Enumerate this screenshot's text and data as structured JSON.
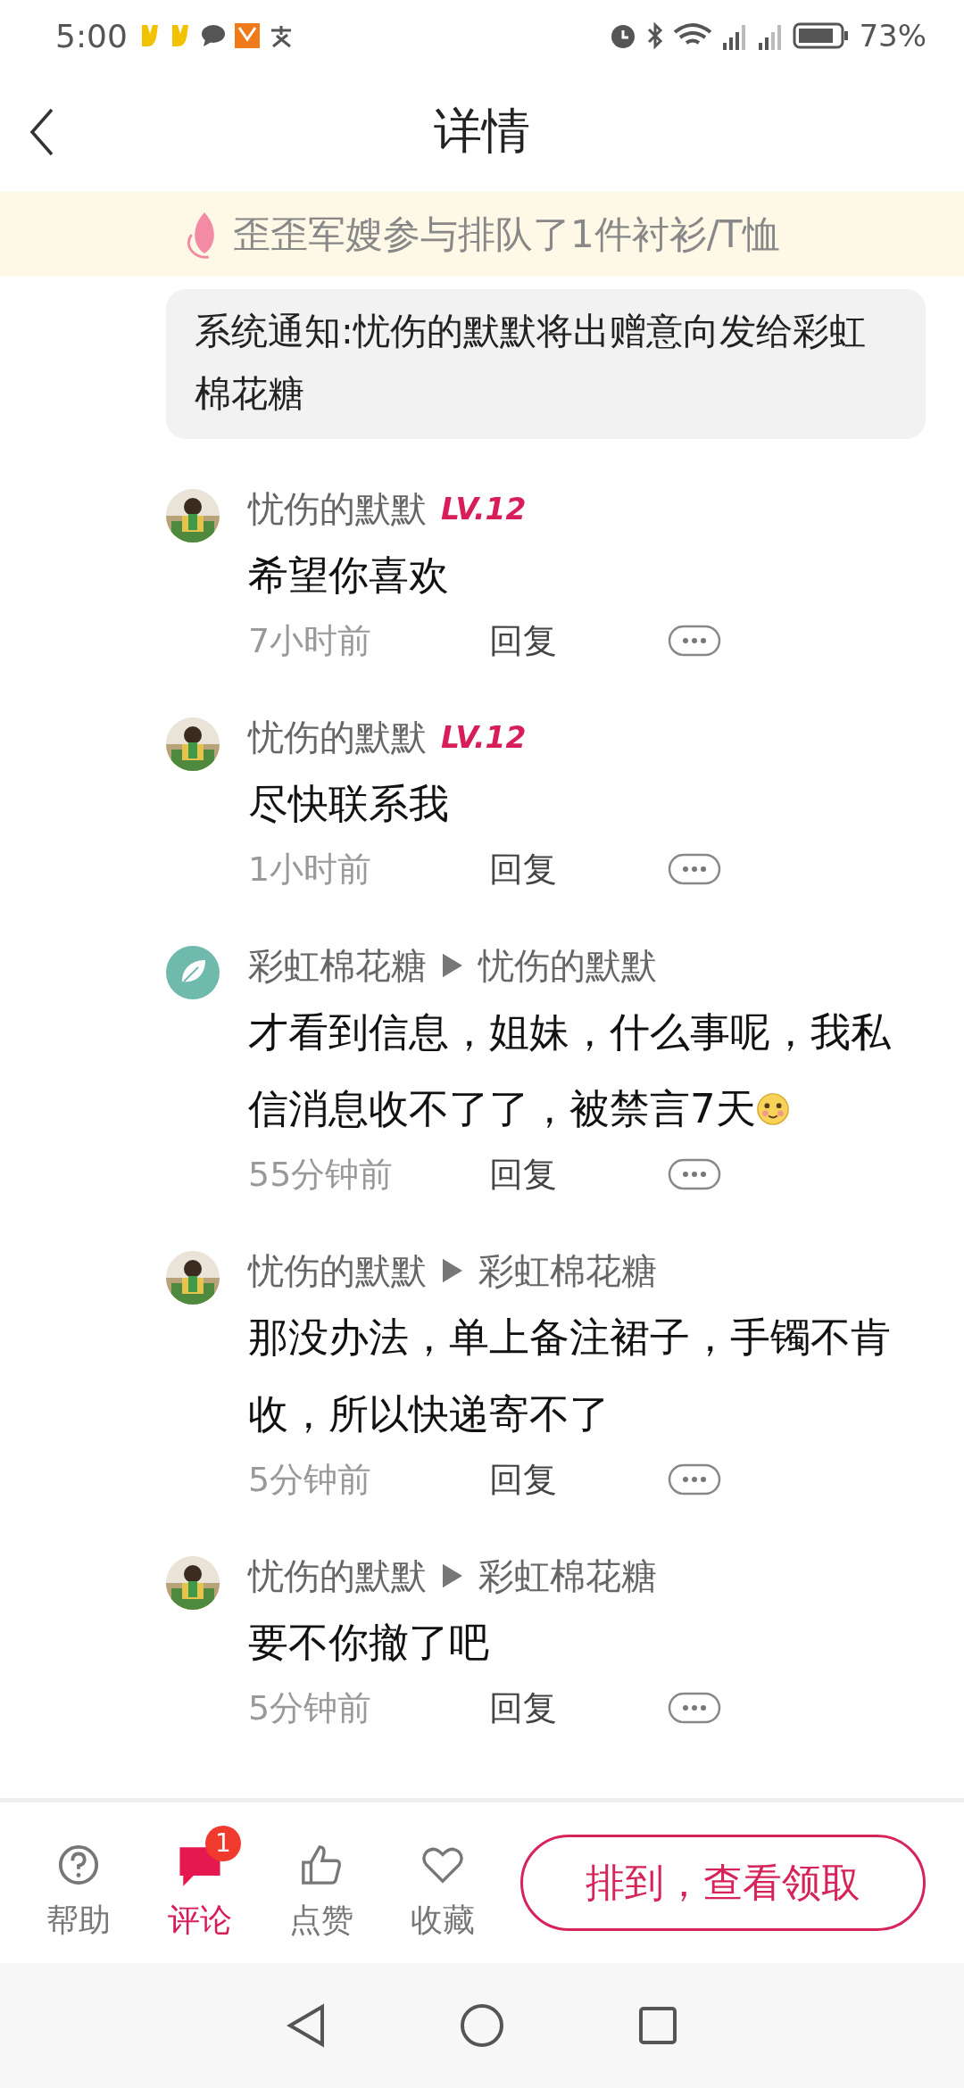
{
  "status_bar": {
    "time": "5:00",
    "battery": "73%"
  },
  "header": {
    "title": "详情"
  },
  "banner": {
    "text": "歪歪军嫂参与排队了1件衬衫/T恤"
  },
  "system_notice": "系统通知:忧伤的默默将出赠意向发给彩虹棉花糖",
  "comments": [
    {
      "author": "忧伤的默默",
      "level": "LV.12",
      "content": "希望你喜欢",
      "time": "7小时前",
      "reply": "回复"
    },
    {
      "author": "忧伤的默默",
      "level": "LV.12",
      "content": "尽快联系我",
      "time": "1小时前",
      "reply": "回复"
    },
    {
      "avatar": {
        "kind": "leaf"
      },
      "author": "彩虹棉花糖",
      "reply_to": "忧伤的默默",
      "content": "才看到信息，姐妹，什么事呢，我私信消息收不了了，被禁言7天",
      "emoji": true,
      "time": "55分钟前",
      "reply": "回复"
    },
    {
      "author": "忧伤的默默",
      "reply_to": "彩虹棉花糖",
      "content": "那没办法，单上备注裙子，手镯不肯收，所以快递寄不了",
      "time": "5分钟前",
      "reply": "回复"
    },
    {
      "author": "忧伤的默默",
      "reply_to": "彩虹棉花糖",
      "content": "要不你撤了吧",
      "time": "5分钟前",
      "reply": "回复"
    }
  ],
  "bottom_bar": {
    "items": [
      {
        "kind": "help",
        "label": "帮助",
        "selected": false
      },
      {
        "kind": "comment",
        "label": "评论",
        "selected": true,
        "badge": "1"
      },
      {
        "kind": "like",
        "label": "点赞",
        "selected": false
      },
      {
        "kind": "favorite",
        "label": "收藏",
        "selected": false
      }
    ],
    "action": "排到，查看领取"
  }
}
